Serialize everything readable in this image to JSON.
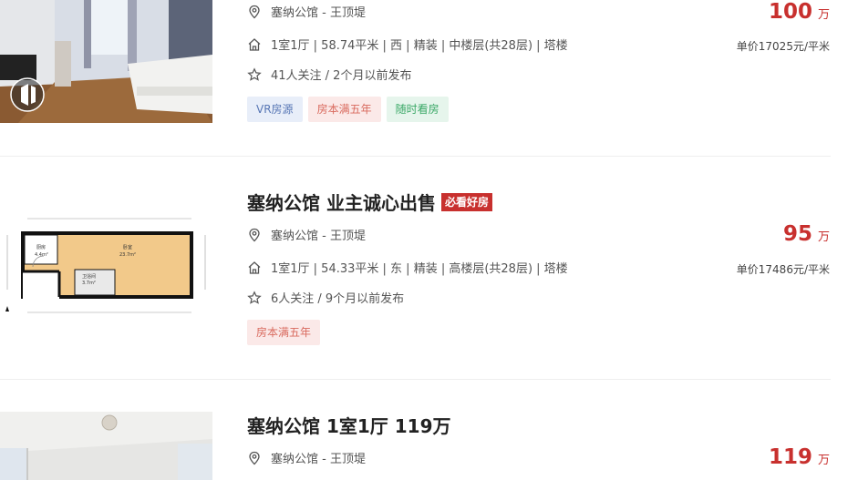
{
  "listings": [
    {
      "title": "",
      "badge": "",
      "location": "塞纳公馆 - 王顶堤",
      "house_info": "1室1厅 | 58.74平米 | 西 | 精装 | 中楼层(共28层) | 塔楼",
      "follow_info": "41人关注 / 2个月以前发布",
      "tags": [
        "VR房源",
        "房本满五年",
        "随时看房"
      ],
      "price": "100",
      "price_unit": "万",
      "unit_price": "单价17025元/平米"
    },
    {
      "title": "塞纳公馆 业主诚心出售",
      "badge": "必看好房",
      "location": "塞纳公馆 - 王顶堤",
      "house_info": "1室1厅 | 54.33平米 | 东 | 精装 | 高楼层(共28层) | 塔楼",
      "follow_info": "6人关注 / 9个月以前发布",
      "tags": [
        "房本满五年"
      ],
      "price": "95",
      "price_unit": "万",
      "unit_price": "单价17486元/平米",
      "floorplan": {
        "room1": "厨房",
        "room1_area": "4.4m²",
        "room2": "卧室",
        "room2_area": "23.7m²",
        "room3": "卫浴间",
        "room3_area": "3.7m²"
      }
    },
    {
      "title": "塞纳公馆 1室1厅 119万",
      "badge": "",
      "location": "塞纳公馆 - 王顶堤",
      "price": "119",
      "price_unit": "万"
    }
  ],
  "icons": {
    "location": "location-pin-icon",
    "house": "house-icon",
    "follow": "star-icon",
    "vr": "vr-play-icon"
  },
  "colors": {
    "price": "#c8302e",
    "badge": "#c8302e"
  }
}
